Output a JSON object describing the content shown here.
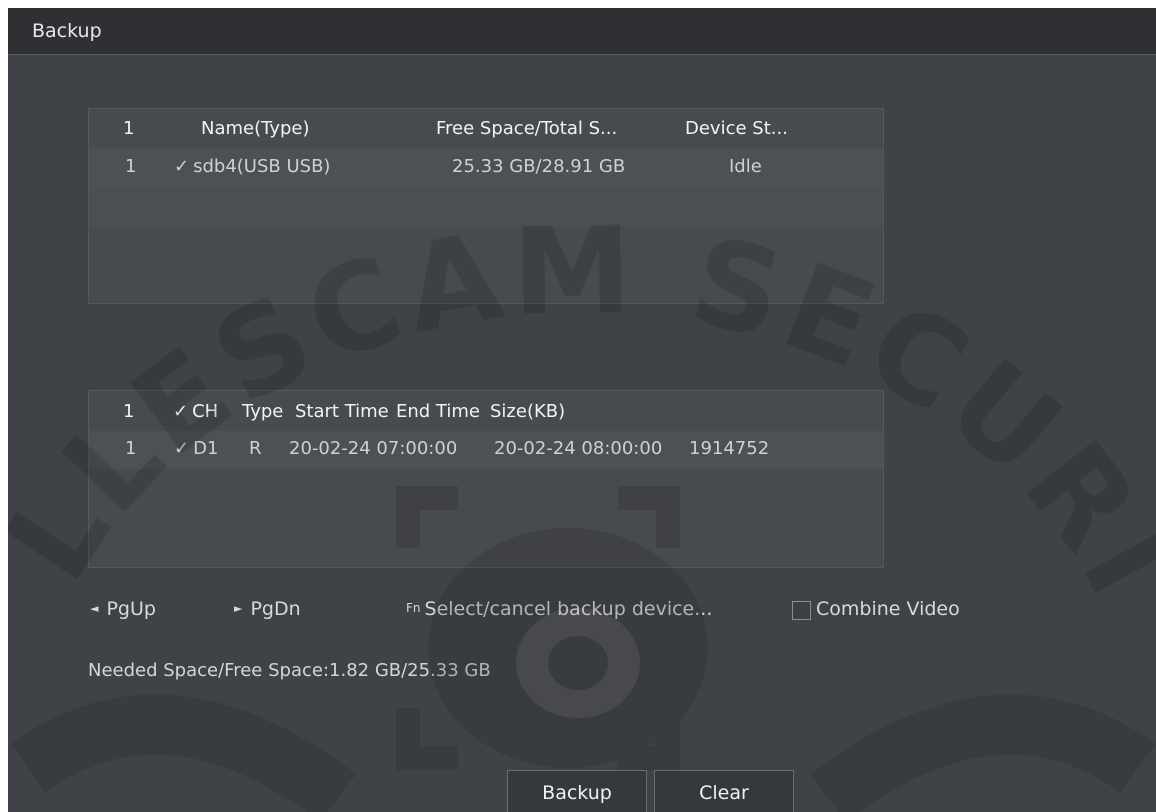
{
  "window": {
    "title": "Backup"
  },
  "devices": {
    "columns": [
      "1",
      "Name(Type)",
      "Free Space/Total S...",
      "Device St..."
    ],
    "rows": [
      {
        "index": "1",
        "checked": "✓",
        "name": "sdb4(USB USB)",
        "space": "25.33 GB/28.91 GB",
        "status": "Idle"
      }
    ]
  },
  "files": {
    "header_index": "1",
    "header_check": "✓",
    "columns": [
      "CH",
      "Type",
      "Start Time",
      "End Time",
      "Size(KB)"
    ],
    "rows": [
      {
        "index": "1",
        "checked": "✓",
        "ch": "D1",
        "type": "R",
        "start": "20-02-24 07:00:00",
        "end": "20-02-24 08:00:00",
        "size": "1914752"
      }
    ]
  },
  "pager": {
    "pgup": "PgUp",
    "pgdn": "PgDn",
    "fn_label": "Select/cancel backup device...",
    "combine_label": "Combine Video"
  },
  "info": {
    "needed": "Needed Space/Free Space:1.82 GB/25.33 GB"
  },
  "buttons": {
    "backup": "Backup",
    "clear": "Clear"
  },
  "watermark": {
    "text": "COLLESCAM SECURITY"
  },
  "colors": {
    "background": "#3f4247",
    "titlebar": "#2e3034",
    "panel": "#474a4f"
  }
}
